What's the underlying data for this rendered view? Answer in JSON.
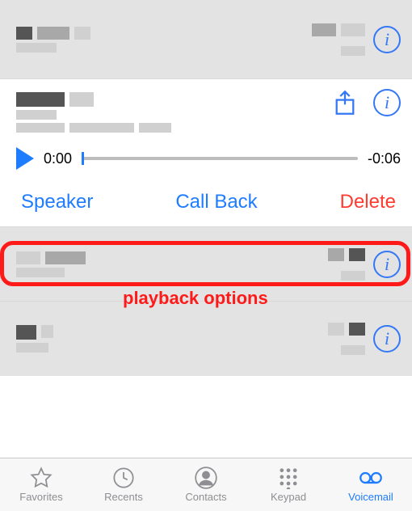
{
  "playback": {
    "current_time": "0:00",
    "remaining_time": "-0:06"
  },
  "options": {
    "speaker": "Speaker",
    "callback": "Call Back",
    "delete": "Delete"
  },
  "annotation": {
    "label": "playback options"
  },
  "tabs": {
    "favorites": "Favorites",
    "recents": "Recents",
    "contacts": "Contacts",
    "keypad": "Keypad",
    "voicemail": "Voicemail"
  }
}
